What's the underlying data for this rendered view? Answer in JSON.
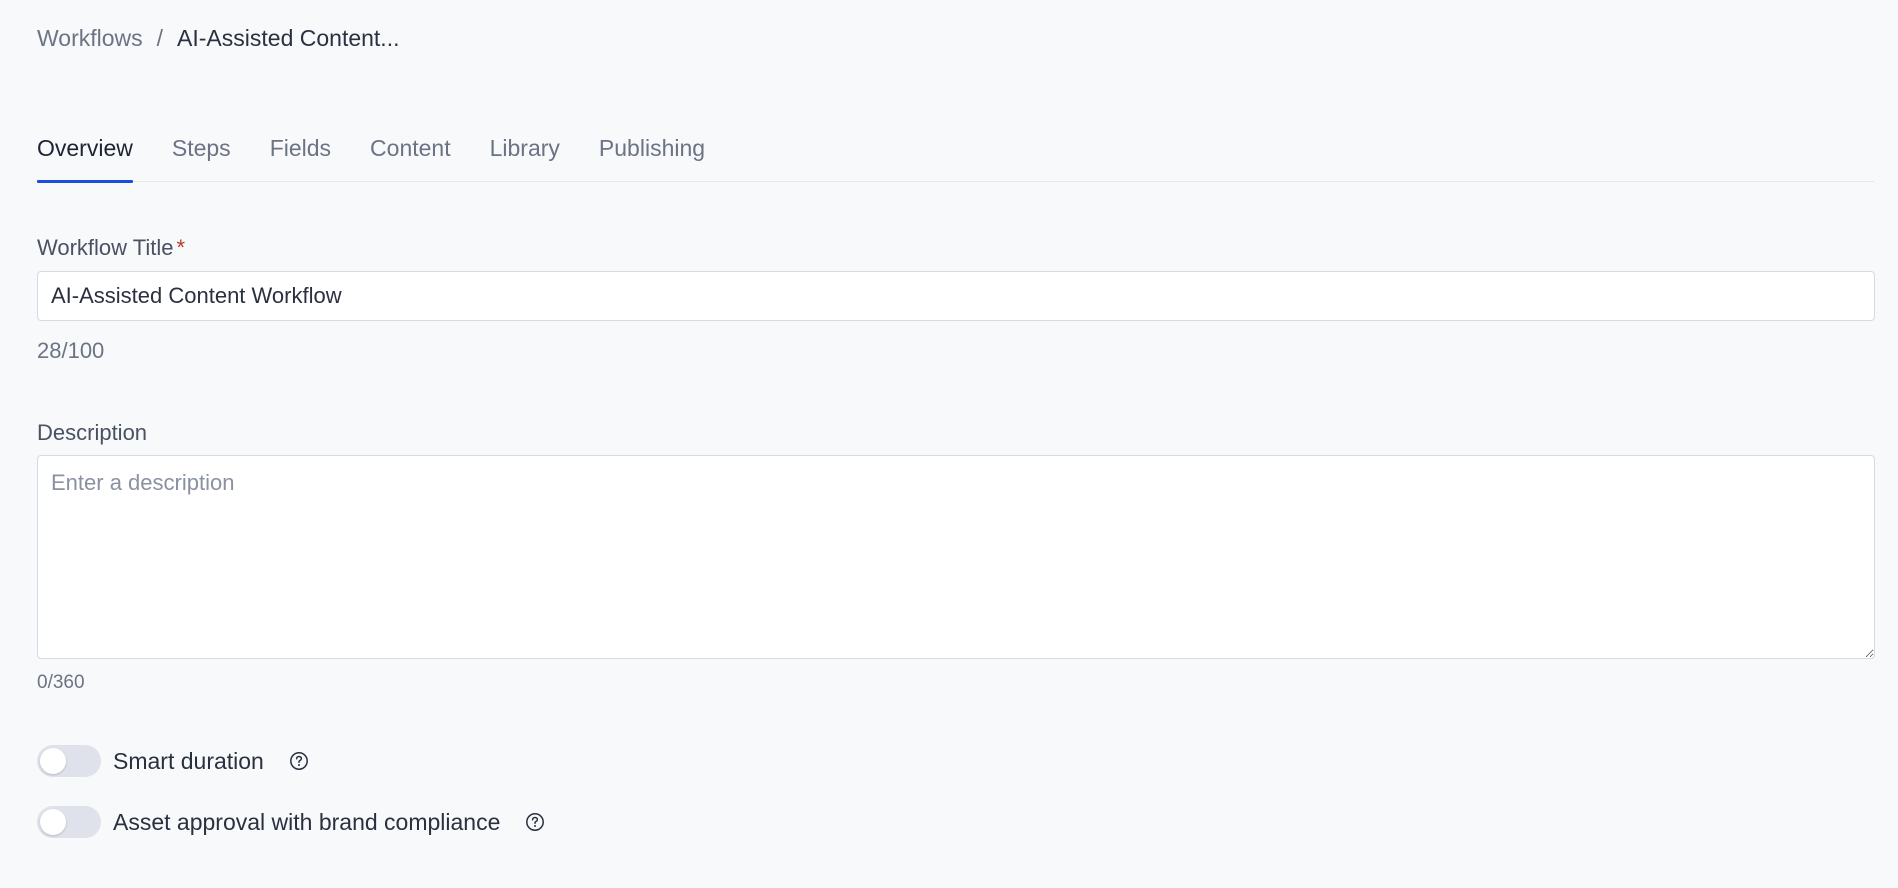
{
  "breadcrumb": {
    "root": "Workflows",
    "separator": "/",
    "current": "AI-Assisted Content..."
  },
  "tabs": [
    {
      "label": "Overview",
      "active": true
    },
    {
      "label": "Steps",
      "active": false
    },
    {
      "label": "Fields",
      "active": false
    },
    {
      "label": "Content",
      "active": false
    },
    {
      "label": "Library",
      "active": false
    },
    {
      "label": "Publishing",
      "active": false
    }
  ],
  "form": {
    "title_label": "Workflow Title",
    "required_mark": "*",
    "title_value": "AI-Assisted Content Workflow",
    "title_counter": "28/100",
    "description_label": "Description",
    "description_placeholder": "Enter a description",
    "description_value": "",
    "description_counter": "0/360"
  },
  "toggles": [
    {
      "label": "Smart duration",
      "enabled": false,
      "help_icon": "question-circle-icon"
    },
    {
      "label": "Asset approval with brand compliance",
      "enabled": false,
      "help_icon": "question-circle-icon"
    }
  ],
  "colors": {
    "accent": "#1d4ed8",
    "required": "#c0392b",
    "background": "#f8f9fb"
  }
}
